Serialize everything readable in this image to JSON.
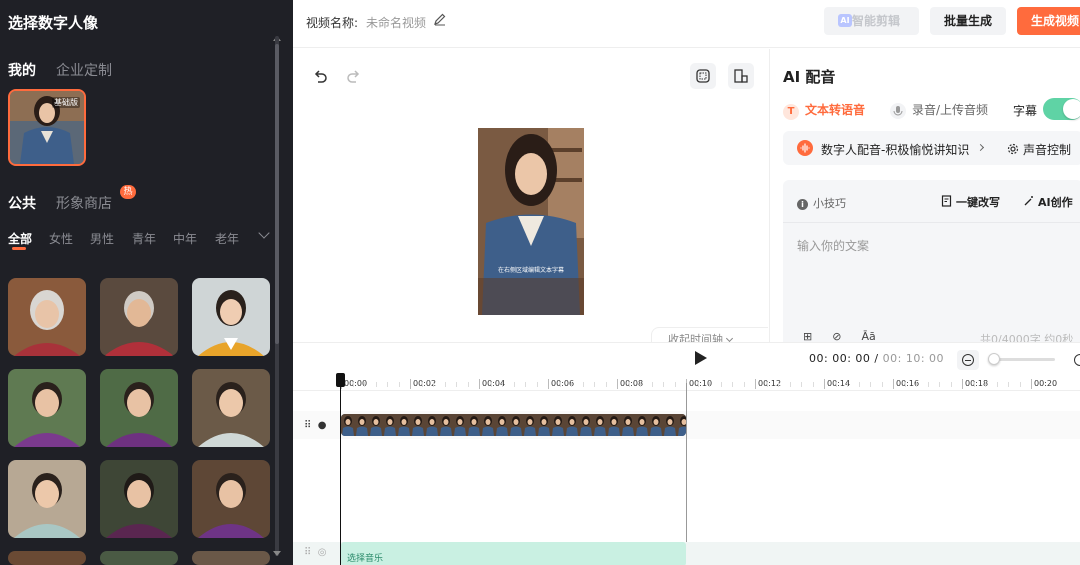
{
  "left_panel": {
    "title": "选择数字人像",
    "tabs_top": [
      "我的",
      "企业定制"
    ],
    "my_card_badge": "基础版",
    "tabs_mid": [
      "公共",
      "形象商店"
    ],
    "hot_badge": "热",
    "filters": [
      "全部",
      "女性",
      "男性",
      "青年",
      "中年",
      "老年"
    ],
    "active_filter": "全部"
  },
  "topbar": {
    "video_name_label": "视频名称:",
    "video_name_value": "未命名视频",
    "ai_edit_label": "智能剪辑",
    "ai_logo": "AI",
    "batch_label": "批量生成",
    "generate_label": "生成视频"
  },
  "preview": {
    "caption": "在右侧区域编辑文本字幕",
    "collapse_timeline": "收起时间轴"
  },
  "right_panel": {
    "title": "AI 配音",
    "tab_tts": "文本转语音",
    "tab_tts_icon": "T",
    "tab_record": "录音/上传音频",
    "subtitle_label": "字幕",
    "subtitle_on": true,
    "voice_name": "数字人配音-积极愉悦讲知识",
    "voice_control": "声音控制",
    "tips": "小技巧",
    "rewrite": "一键改写",
    "ai_create": "AI创作",
    "placeholder": "输入你的文案",
    "char_count": "共0/4000字 约0秒",
    "bottom_tools": [
      "⊞",
      "⊘",
      "Āā"
    ]
  },
  "timeline": {
    "current_time": "00: 00: 00",
    "separator": "/",
    "total_time": "00: 10: 00",
    "ticks": [
      "00:00",
      "00:02",
      "00:04",
      "00:06",
      "00:08",
      "00:10",
      "00:12",
      "00:14",
      "00:16",
      "00:18",
      "00:20"
    ],
    "music_label": "选择音乐"
  },
  "colors": {
    "accent": "#ff6b3d",
    "toggle": "#5fd3a5",
    "music": "#c9f0e2"
  }
}
